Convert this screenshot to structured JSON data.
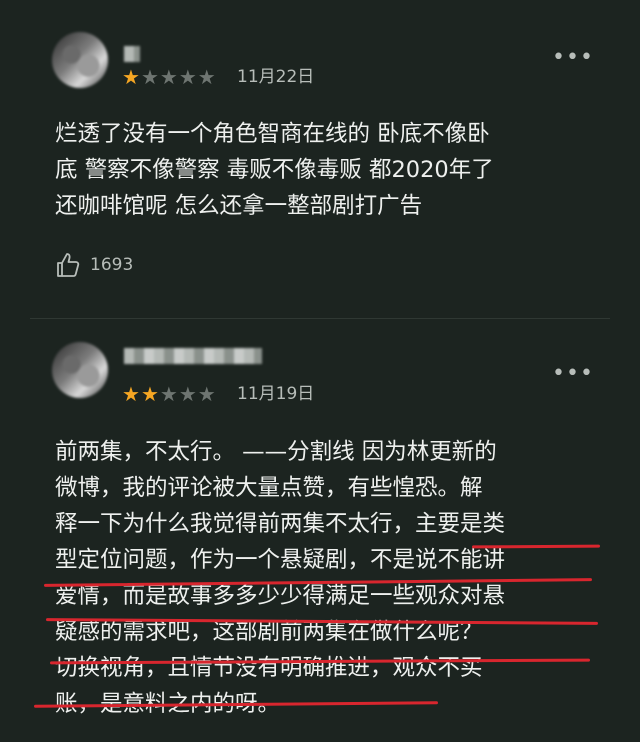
{
  "reviews": [
    {
      "rating": 1,
      "max_rating": 5,
      "date": "11月22日",
      "more_label": "•••",
      "text_lines": [
        "烂透了没有一个角色智商在线的 卧底不像卧",
        "底 警察不像警察 毒贩不像毒贩 都2020年了",
        "还咖啡馆呢 怎么还拿一整部剧打广告"
      ],
      "likes": "1693"
    },
    {
      "rating": 2,
      "max_rating": 5,
      "date": "11月19日",
      "more_label": "•••",
      "text_lines": [
        "前两集，不太行。 ——分割线 因为林更新的",
        "微博，我的评论被大量点赞，有些惶恐。解",
        "释一下为什么我觉得前两集不太行，主要是类",
        "型定位问题，作为一个悬疑剧，不是说不能讲",
        "爱情，而是故事多多少少得满足一些观众对悬",
        "疑感的需求吧，这部剧前两集在做什么呢？",
        "切换视角，且情节没有明确推进，观众不买",
        "账，是意料之内的呀。"
      ]
    }
  ],
  "colors": {
    "background": "#1c2420",
    "star_active": "#f5a623",
    "star_inactive": "#6e7571",
    "underline": "#d8262e"
  }
}
